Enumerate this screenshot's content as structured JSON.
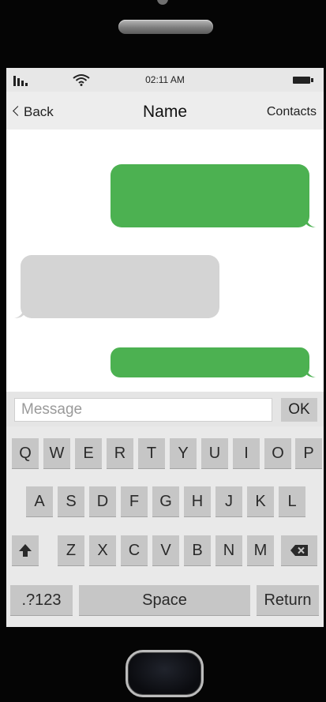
{
  "status_bar": {
    "time": "02:11 AM",
    "signal_icon": "signal-bars-icon",
    "wifi_icon": "wifi-icon",
    "battery_icon": "battery-icon"
  },
  "nav": {
    "back_label": "Back",
    "title": "Name",
    "contacts_label": "Contacts"
  },
  "messages": [
    {
      "direction": "outgoing",
      "color": "#4cb151"
    },
    {
      "direction": "incoming",
      "color": "#d4d4d4"
    },
    {
      "direction": "outgoing",
      "color": "#4cb151"
    }
  ],
  "composer": {
    "placeholder": "Message",
    "value": "",
    "send_label": "OK"
  },
  "keyboard": {
    "row1": [
      "Q",
      "W",
      "E",
      "R",
      "T",
      "Y",
      "U",
      "I",
      "O",
      "P"
    ],
    "row2": [
      "A",
      "S",
      "D",
      "F",
      "G",
      "H",
      "J",
      "K",
      "L"
    ],
    "row3": [
      "Z",
      "X",
      "C",
      "V",
      "B",
      "N",
      "M"
    ],
    "shift_icon": "shift-arrow-icon",
    "backspace_icon": "backspace-icon",
    "numbers_label": ".?123",
    "space_label": "Space",
    "return_label": "Return"
  },
  "colors": {
    "outgoing_bubble": "#4cb151",
    "incoming_bubble": "#d4d4d4",
    "key": "#c6c6c6",
    "phone_body": "#050505"
  }
}
